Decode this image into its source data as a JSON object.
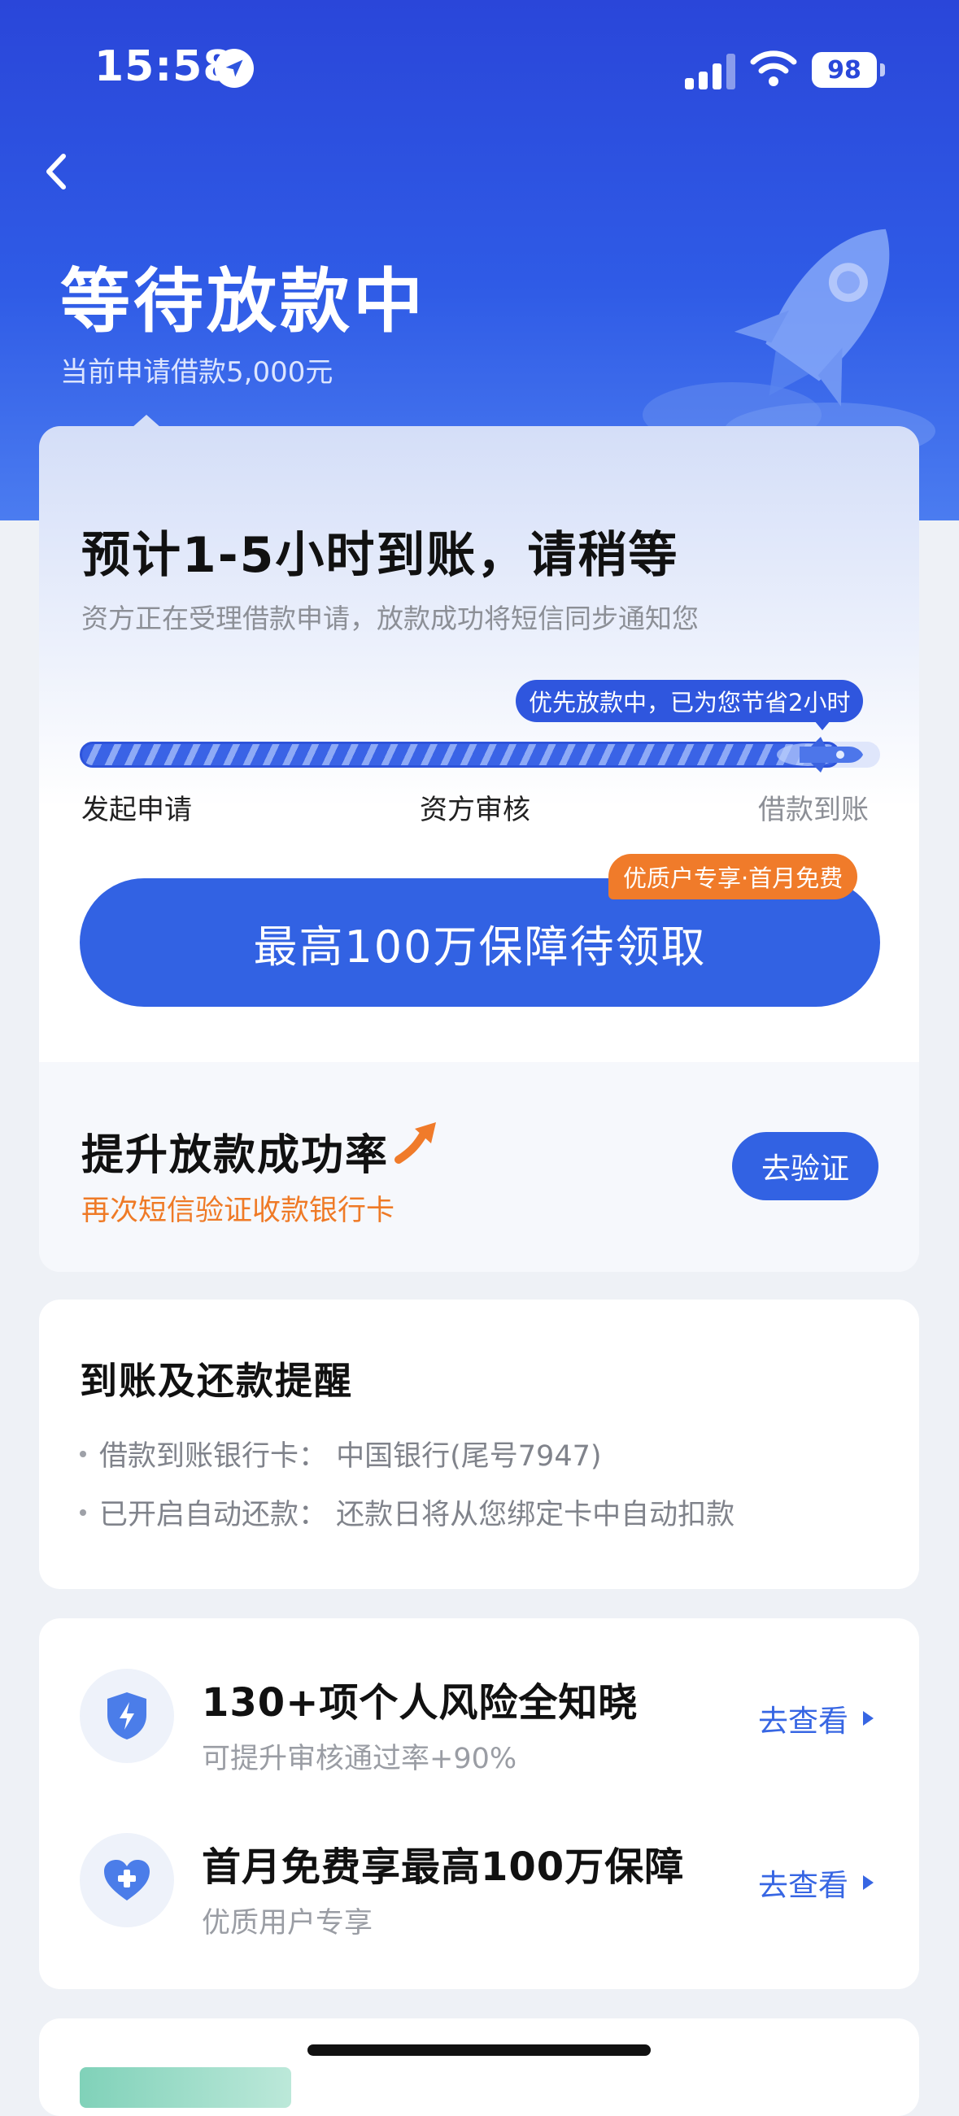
{
  "status_bar": {
    "time": "15:58",
    "battery": "98"
  },
  "header": {
    "title": "等待放款中",
    "subtitle": "当前申请借款5,000元"
  },
  "progress_card": {
    "eta_title": "预计1-5小时到账，请稍等",
    "eta_subtitle": "资方正在受理借款申请，放款成功将短信同步通知您",
    "save_tip": "优先放款中，已为您节省2小时",
    "progress_fraction": 0.95,
    "steps": [
      "发起申请",
      "资方审核",
      "借款到账"
    ],
    "promo_tag": "优质户专享·首月免费",
    "promo_button": "最高100万保障待领取"
  },
  "boost": {
    "title": "提升放款成功率",
    "subtitle": "再次短信验证收款银行卡",
    "button": "去验证"
  },
  "reminder": {
    "title": "到账及还款提醒",
    "lines": [
      "借款到账银行卡： 中国银行(尾号7947)",
      "已开启自动还款： 还款日将从您绑定卡中自动扣款"
    ]
  },
  "services": [
    {
      "icon": "shield-bolt-icon",
      "title": "130+项个人风险全知晓",
      "subtitle": "可提升审核通过率+90%",
      "link": "去查看"
    },
    {
      "icon": "heart-plus-icon",
      "title": "首月免费享最高100万保障",
      "subtitle": "优质用户专享",
      "link": "去查看"
    }
  ],
  "colors": {
    "primary": "#3262e3",
    "accent_orange": "#f07b2a",
    "header_bg": "#2a46d9"
  }
}
